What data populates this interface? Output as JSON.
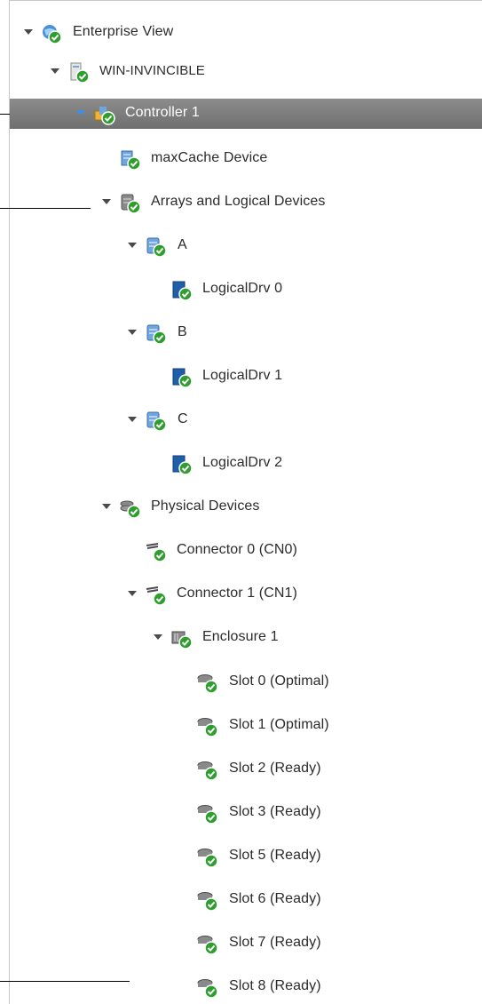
{
  "tree": {
    "enterprise_view": "Enterprise View",
    "host": "WIN-INVINCIBLE",
    "controller": "Controller 1",
    "maxcache": "maxCache Device",
    "arrays": "Arrays and Logical Devices",
    "array_a": "A",
    "logical_0": "LogicalDrv 0",
    "array_b": "B",
    "logical_1": "LogicalDrv 1",
    "array_c": "C",
    "logical_2": "LogicalDrv 2",
    "physical": "Physical Devices",
    "connector_0": "Connector 0 (CN0)",
    "connector_1": "Connector 1 (CN1)",
    "enclosure": "Enclosure 1",
    "slots": [
      "Slot 0 (Optimal)",
      "Slot 1 (Optimal)",
      "Slot 2 (Ready)",
      "Slot 3 (Ready)",
      "Slot 5 (Ready)",
      "Slot 6 (Ready)",
      "Slot 7 (Ready)",
      "Slot 8 (Ready)"
    ]
  },
  "icons": {
    "enterprise": "globe-icon",
    "host": "server-icon",
    "controller": "controller-icon",
    "maxcache": "cache-device-icon",
    "array": "array-icon",
    "logical": "logical-drive-icon",
    "physical": "physical-devices-icon",
    "connector": "connector-icon",
    "enclosure": "enclosure-icon",
    "disk": "disk-icon",
    "status_ok": "check-status-icon"
  },
  "colors": {
    "selected_row": "#7a7a7a",
    "status_ok": "#2f9e2f",
    "expand_arrow_selected": "#3c8fe8"
  }
}
